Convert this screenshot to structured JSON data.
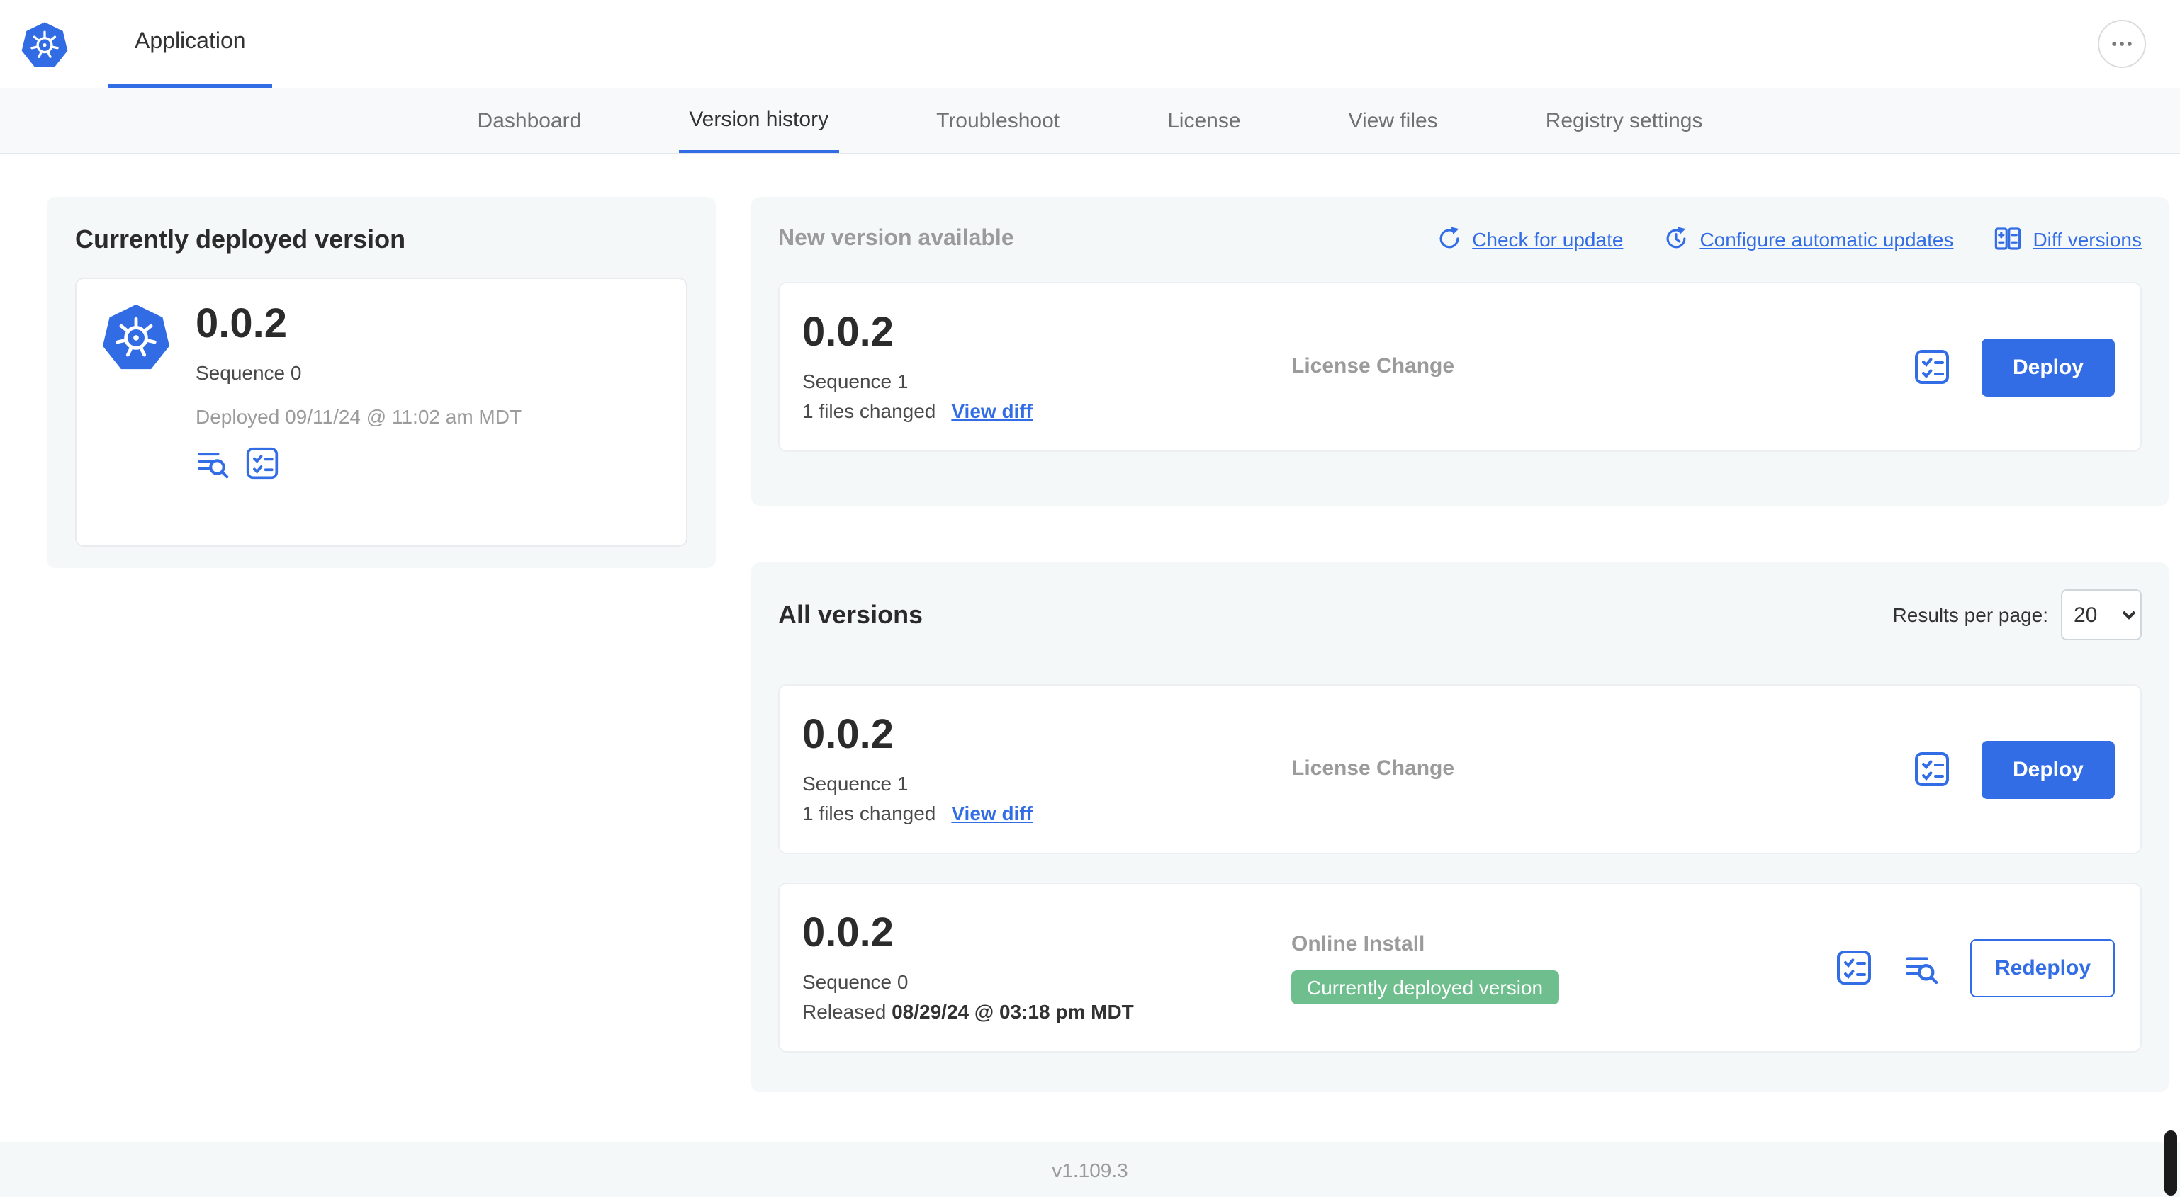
{
  "header": {
    "app_tab": "Application"
  },
  "nav": {
    "active_tab": "Version history",
    "tabs": [
      {
        "label": "Dashboard"
      },
      {
        "label": "Version history"
      },
      {
        "label": "Troubleshoot"
      },
      {
        "label": "License"
      },
      {
        "label": "View files"
      },
      {
        "label": "Registry settings"
      }
    ]
  },
  "current_version": {
    "heading": "Currently deployed version",
    "version": "0.0.2",
    "sequence": "Sequence 0",
    "deployed_at": "Deployed 09/11/24 @ 11:02 am MDT"
  },
  "new_version": {
    "heading": "New version available",
    "check_for_update": "Check for update",
    "configure_updates": "Configure automatic updates",
    "diff_versions": "Diff versions",
    "version": "0.0.2",
    "sequence": "Sequence 1",
    "files_changed": "1 files changed",
    "view_diff": "View diff",
    "source": "License Change",
    "deploy": "Deploy"
  },
  "all_versions": {
    "heading": "All versions",
    "results_per_page_label": "Results per page:",
    "results_per_page": "20",
    "rows": [
      {
        "version": "0.0.2",
        "sequence": "Sequence 1",
        "files_changed": "1 files changed",
        "view_diff": "View diff",
        "source": "License Change",
        "action": "Deploy"
      },
      {
        "version": "0.0.2",
        "sequence": "Sequence 0",
        "released_label": "Released ",
        "released_date": "08/29/24 @ 03:18 pm MDT",
        "source": "Online Install",
        "badge": "Currently deployed version",
        "action": "Redeploy"
      }
    ]
  },
  "footer": {
    "version": "v1.109.3"
  },
  "colors": {
    "accent_blue": "#326de6",
    "kubernetes_blue": "#326ce5",
    "badge_green": "#6fbe8e",
    "panel_gray": "#f5f8f9",
    "muted_gray": "#9b9b9b"
  },
  "icons": {
    "logo": "kubernetes-wheel",
    "more": "ellipsis-dots",
    "check_update": "refresh-arrow",
    "auto_updates": "clock-refresh",
    "diff": "diff-columns",
    "preflight": "checklist",
    "release_notes": "lines-magnifier"
  }
}
